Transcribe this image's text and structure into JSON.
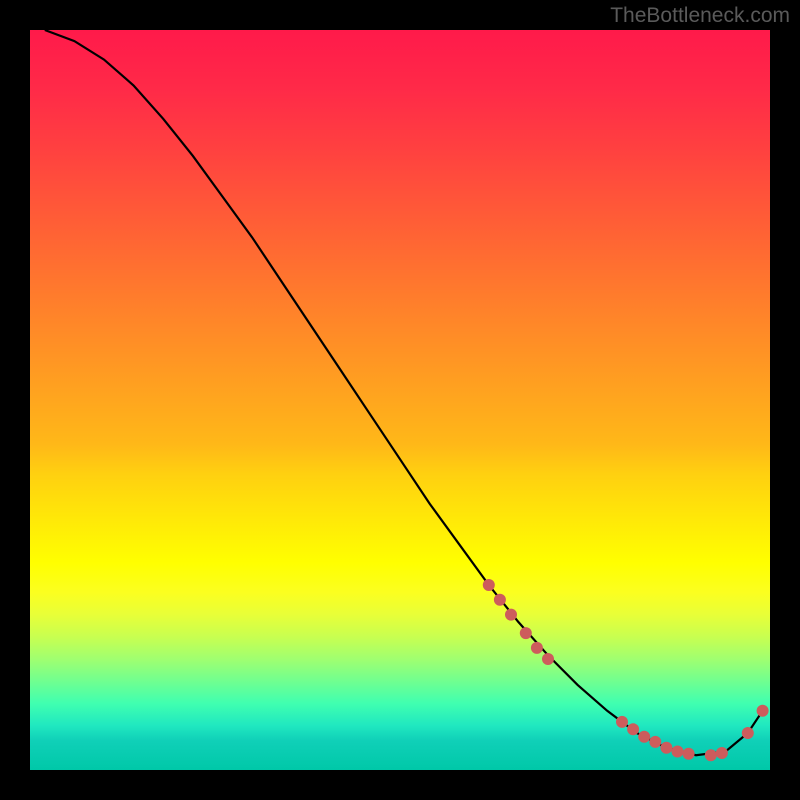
{
  "watermark": "TheBottleneck.com",
  "colors": {
    "background": "#000000",
    "gradient_top": "#ff1a4a",
    "gradient_bottom": "#00c8a8",
    "curve": "#000000",
    "marker": "#cd5c5c"
  },
  "chart_data": {
    "type": "line",
    "title": "",
    "xlabel": "",
    "ylabel": "",
    "xlim": [
      0,
      100
    ],
    "ylim": [
      0,
      100
    ],
    "curve": {
      "x": [
        2,
        6,
        10,
        14,
        18,
        22,
        26,
        30,
        34,
        38,
        42,
        46,
        50,
        54,
        58,
        62,
        66,
        70,
        74,
        78,
        82,
        86,
        90,
        94,
        97,
        99
      ],
      "y": [
        100,
        98.5,
        96,
        92.5,
        88,
        83,
        77.5,
        72,
        66,
        60,
        54,
        48,
        42,
        36,
        30.5,
        25,
        20,
        15.5,
        11.5,
        8,
        5,
        3,
        2,
        2.5,
        5,
        8
      ]
    },
    "markers": [
      {
        "x": 62,
        "y": 25
      },
      {
        "x": 63.5,
        "y": 23
      },
      {
        "x": 65,
        "y": 21
      },
      {
        "x": 67,
        "y": 18.5
      },
      {
        "x": 68.5,
        "y": 16.5
      },
      {
        "x": 70,
        "y": 15
      },
      {
        "x": 80,
        "y": 6.5
      },
      {
        "x": 81.5,
        "y": 5.5
      },
      {
        "x": 83,
        "y": 4.5
      },
      {
        "x": 84.5,
        "y": 3.8
      },
      {
        "x": 86,
        "y": 3
      },
      {
        "x": 87.5,
        "y": 2.5
      },
      {
        "x": 89,
        "y": 2.2
      },
      {
        "x": 92,
        "y": 2
      },
      {
        "x": 93.5,
        "y": 2.3
      },
      {
        "x": 97,
        "y": 5
      },
      {
        "x": 99,
        "y": 8
      }
    ]
  }
}
